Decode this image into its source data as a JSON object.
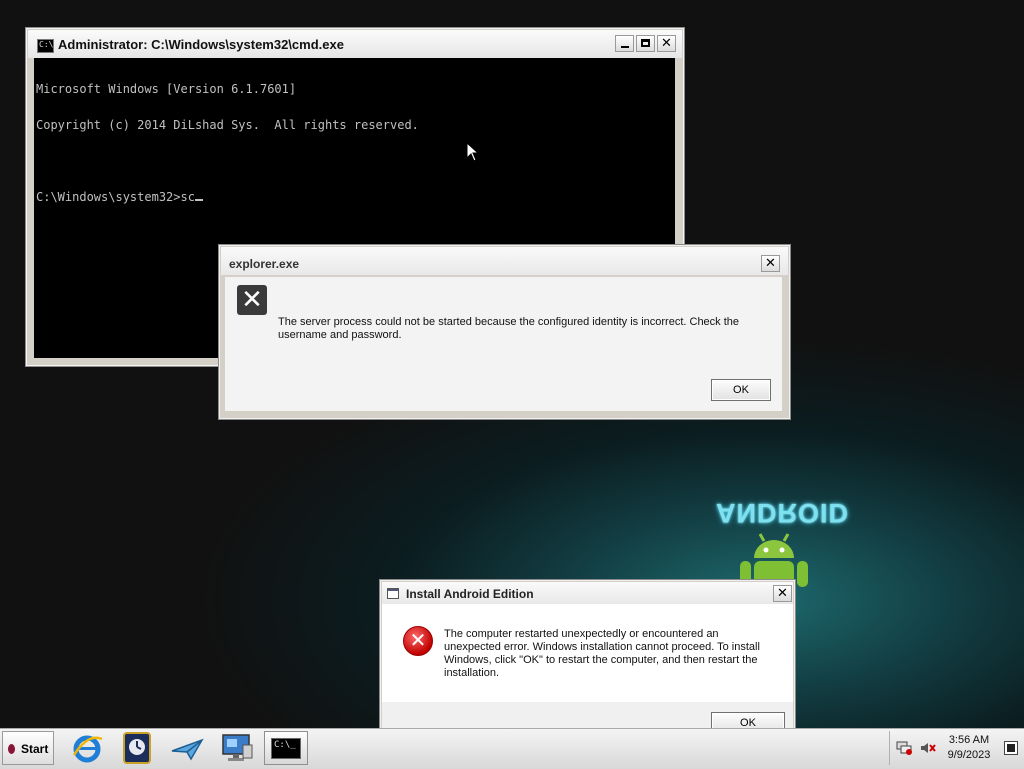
{
  "desktop": {
    "android_logo_text": "ANDROID"
  },
  "cmd": {
    "title": "Administrator: C:\\Windows\\system32\\cmd.exe",
    "title_icon_text": "C:\\",
    "lines": [
      "Microsoft Windows [Version 6.1.7601]",
      "Copyright (c) 2014 DiLshad Sys.  All rights reserved.",
      "",
      "C:\\Windows\\system32>sc"
    ]
  },
  "explorer_dialog": {
    "title": "explorer.exe",
    "icon_glyph": "✕",
    "message": "The server process could not be started because the configured identity is incorrect. Check the username and password.",
    "ok_label": "OK"
  },
  "install_dialog": {
    "title": "Install Android Edition",
    "icon_glyph": "✕",
    "message": "The computer restarted unexpectedly or encountered an unexpected error. Windows installation cannot proceed. To install Windows, click \"OK\" to restart the computer, and then restart the installation.",
    "ok_label": "OK"
  },
  "window_controls": {
    "close_glyph": "✕"
  },
  "taskbar": {
    "start_label": "Start",
    "pinned": [
      "internet-explorer-icon",
      "clock-app-icon",
      "paper-plane-icon",
      "monitor-icon",
      "cmd-icon"
    ],
    "cmd_task_text": "C:\\_",
    "time": "3:56 AM",
    "date": "9/9/2023"
  },
  "colors": {
    "console_bg": "#000000",
    "console_fg": "#c0c0c0",
    "error_red": "#c00000",
    "desktop_teal": "#1d6a6e"
  }
}
